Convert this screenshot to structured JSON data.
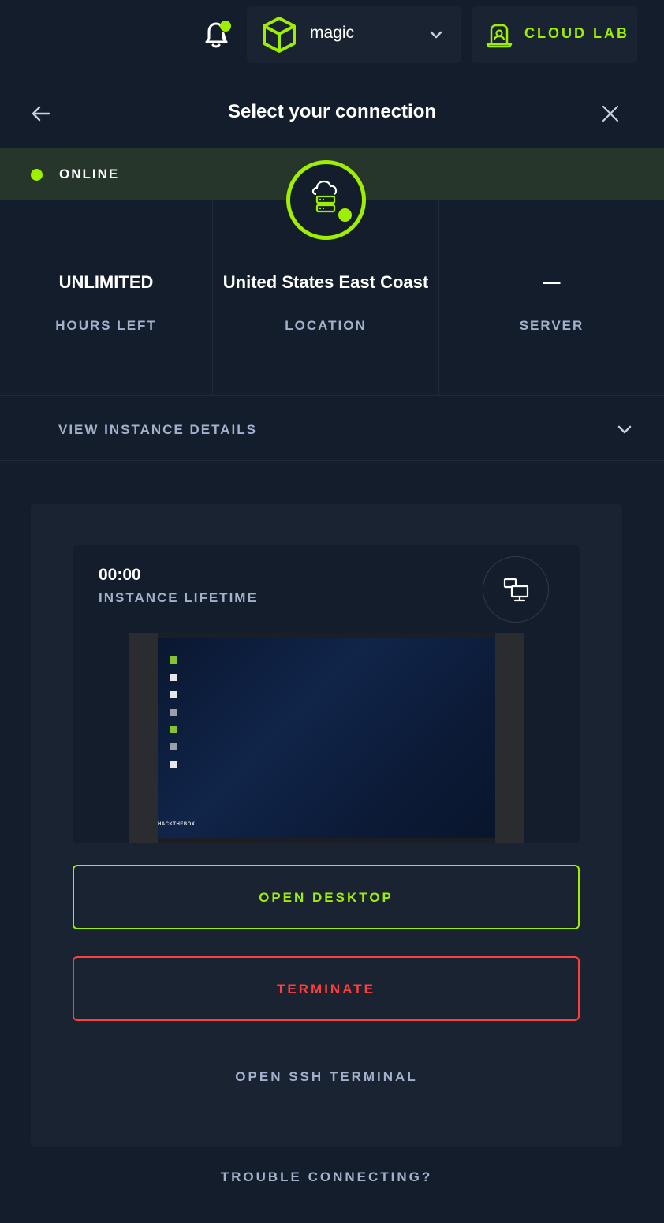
{
  "colors": {
    "accent": "#9fef00",
    "danger": "#ff3e3e",
    "background": "#141d2b",
    "panel": "#1a2332",
    "muted": "#a4b1cd"
  },
  "topbar": {
    "workspace_name": "magic",
    "cloud_lab_label": "CLOUD LAB",
    "icons": [
      "bell-icon",
      "cube-icon",
      "chevron-down-icon",
      "cloud-lab-icon"
    ]
  },
  "header": {
    "title": "Select your connection"
  },
  "status": {
    "text": "ONLINE"
  },
  "stats": [
    {
      "value": "UNLIMITED",
      "label": "HOURS LEFT"
    },
    {
      "value": "United States East Coast",
      "label": "LOCATION"
    },
    {
      "value": "—",
      "label": "SERVER"
    }
  ],
  "details": {
    "label": "VIEW INSTANCE DETAILS"
  },
  "instance": {
    "lifetime_value": "00:00",
    "lifetime_label": "INSTANCE LIFETIME",
    "preview_brand": "HACKTHEBOX"
  },
  "actions": {
    "open_desktop": "OPEN DESKTOP",
    "terminate": "TERMINATE",
    "open_ssh": "OPEN SSH TERMINAL"
  },
  "footer": {
    "trouble": "TROUBLE CONNECTING?"
  }
}
